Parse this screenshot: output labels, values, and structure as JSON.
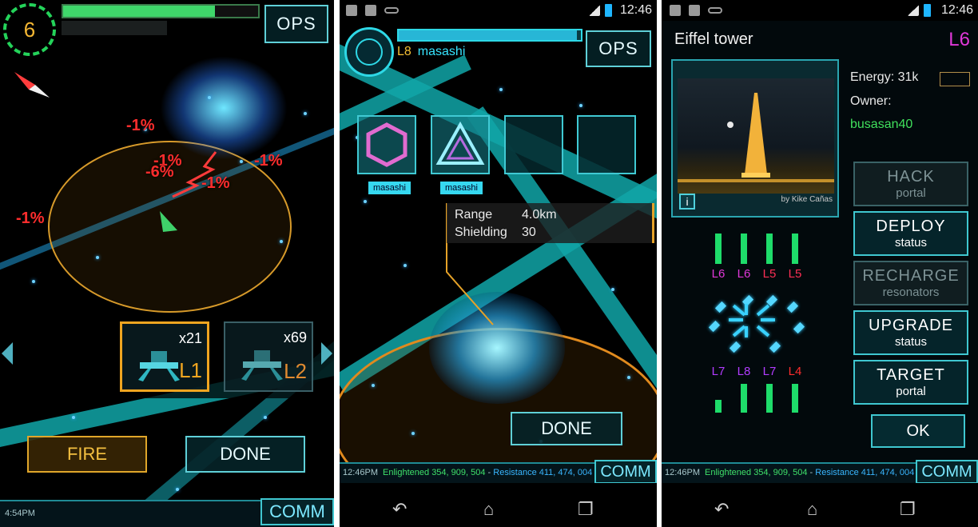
{
  "screen1": {
    "player_level": "6",
    "xp_fill": 0.78,
    "ops_label": "OPS",
    "damage_labels": [
      "-1%",
      "-1%",
      "-6%",
      "-1%",
      "-1%",
      "-1%"
    ],
    "weapons": [
      {
        "count": "x21",
        "level": "L1",
        "level_color": "#f0a520"
      },
      {
        "count": "x69",
        "level": "L2",
        "level_color": "#e08a30"
      }
    ],
    "fire_label": "FIRE",
    "done_label": "DONE",
    "time": "4:54PM",
    "comm_label": "COMM"
  },
  "screen2": {
    "status_time": "12:46",
    "portal_level": "L8",
    "owner": "masashi",
    "energy_fill": 0.98,
    "ops_label": "OPS",
    "mods": [
      {
        "owner": "masashi",
        "icon": "shield-mod-icon"
      },
      {
        "owner": "masashi",
        "icon": "heatsink-mod-icon"
      },
      {
        "owner": "",
        "icon": ""
      },
      {
        "owner": "",
        "icon": ""
      }
    ],
    "range_label": "Range",
    "range_value": "4.0km",
    "shielding_label": "Shielding",
    "shielding_value": "30",
    "done_label": "DONE",
    "ticker": {
      "time": "12:46PM",
      "enlightened": "Enlightened 354, 909, 504",
      "separator": "-",
      "resistance": "Resistance 411, 474, 004"
    },
    "comm_label": "COMM"
  },
  "screen3": {
    "status_time": "12:46",
    "portal_name": "Eiffel tower",
    "portal_level": "L6",
    "energy_label": "Energy:",
    "energy_value": "31k",
    "owner_label": "Owner:",
    "owner_name": "busasan40",
    "photo_credit": "by Kike Cañas",
    "info_icon": "i",
    "actions": [
      {
        "line1": "HACK",
        "line2": "portal",
        "enabled": false
      },
      {
        "line1": "DEPLOY",
        "line2": "status",
        "enabled": true
      },
      {
        "line1": "RECHARGE",
        "line2": "resonators",
        "enabled": false
      },
      {
        "line1": "UPGRADE",
        "line2": "status",
        "enabled": true
      },
      {
        "line1": "TARGET",
        "line2": "portal",
        "enabled": true
      }
    ],
    "ok_label": "OK",
    "resonators_top": [
      {
        "level": "L6",
        "color": "#e038d8",
        "fill": 1.0
      },
      {
        "level": "L6",
        "color": "#e038d8",
        "fill": 1.0
      },
      {
        "level": "L5",
        "color": "#ff2f55",
        "fill": 1.0
      },
      {
        "level": "L5",
        "color": "#ff2f55",
        "fill": 1.0
      }
    ],
    "resonators_bottom": [
      {
        "level": "L7",
        "color": "#b23cff",
        "fill": 0.45
      },
      {
        "level": "L8",
        "color": "#b23cff",
        "fill": 1.0
      },
      {
        "level": "L7",
        "color": "#b23cff",
        "fill": 1.0
      },
      {
        "level": "L4",
        "color": "#ff2d2d",
        "fill": 1.0
      }
    ],
    "ticker": {
      "time": "12:46PM",
      "enlightened": "Enlightened 354, 909, 504",
      "separator": "-",
      "resistance": "Resistance 411, 474, 004"
    },
    "comm_label": "COMM"
  },
  "nav": {
    "back": "back-icon",
    "home": "home-icon",
    "recent": "recent-apps-icon"
  }
}
